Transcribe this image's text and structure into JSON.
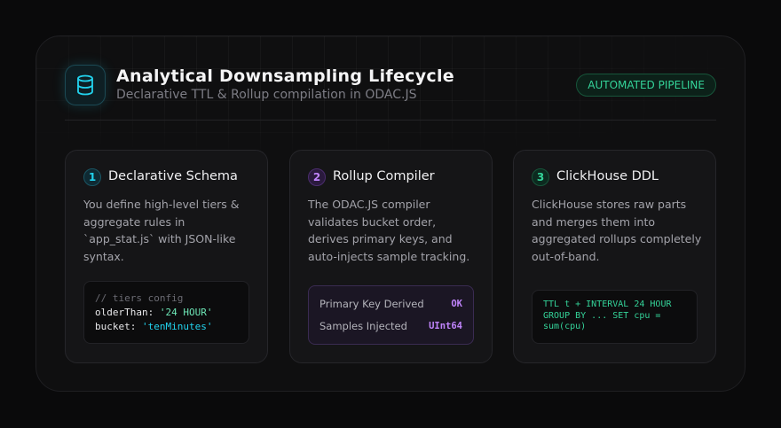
{
  "header": {
    "title": "Analytical Downsampling Lifecycle",
    "subtitle": "Declarative TTL & Rollup compilation in ODAC.JS",
    "badge": "AUTOMATED PIPELINE",
    "icon": "database-icon"
  },
  "colors": {
    "accent_cyan": "#22d3ee",
    "accent_purple": "#c084fc",
    "accent_green": "#34d399",
    "background": "#0a0a0b"
  },
  "cards": [
    {
      "number": "1",
      "title": "Declarative Schema",
      "description": "You define high-level tiers & aggregate rules in `app_stat.js` with JSON-like syntax.",
      "code": {
        "comment": "// tiers config",
        "line1_key": "olderThan: ",
        "line1_value": "'24 HOUR'",
        "line2_key": "bucket: ",
        "line2_value": "'tenMinutes'"
      }
    },
    {
      "number": "2",
      "title": "Rollup Compiler",
      "description": "The ODAC.JS compiler validates bucket order, derives primary keys, and auto-injects sample tracking.",
      "rows": [
        {
          "label": "Primary Key Derived",
          "value": "OK"
        },
        {
          "label": "Samples Injected",
          "value": "UInt64"
        }
      ]
    },
    {
      "number": "3",
      "title": "ClickHouse DDL",
      "description": "ClickHouse stores raw parts and merges them into aggregated rollups completely out-of-band.",
      "ddl": "TTL t + INTERVAL 24 HOUR GROUP BY ... SET cpu = sum(cpu)"
    }
  ]
}
